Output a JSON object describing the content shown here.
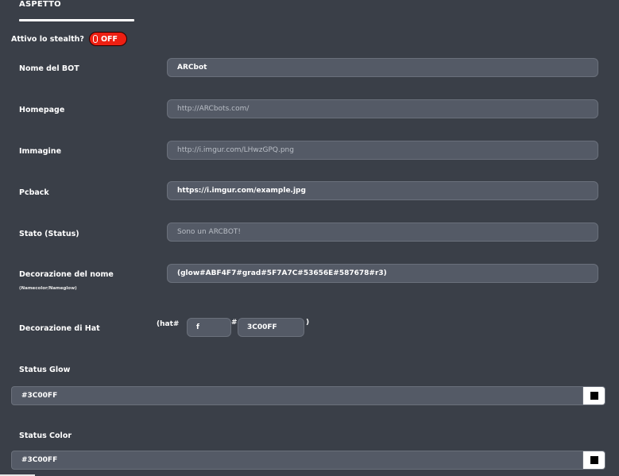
{
  "tab": {
    "title": "ASPETTO"
  },
  "stealth": {
    "label": "Attivo lo stealth?",
    "toggle_text": "OFF",
    "toggle_color": "#ee1f12"
  },
  "fields": {
    "bot_name": {
      "label": "Nome del BOT",
      "value": "ARCbot"
    },
    "homepage": {
      "label": "Homepage",
      "placeholder": "http://ARCbots.com/"
    },
    "image": {
      "label": "Immagine",
      "placeholder": "http://i.imgur.com/LHwzGPQ.png"
    },
    "pcback": {
      "label": "Pcback",
      "value": "https://i.imgur.com/example.jpg"
    },
    "status": {
      "label": "Stato (Status)",
      "placeholder": "Sono un ARCBOT!"
    },
    "name_decoration": {
      "label": "Decorazione del nome",
      "sub_label": "(Namecolor/Nameglow)",
      "value": "(glow#ABF4F7#grad#5F7A7C#53656E#587678#r3)"
    },
    "hat_decoration": {
      "label": "Decorazione di Hat",
      "prefix": "(hat#",
      "hash": "#",
      "suffix": ")",
      "code": "f",
      "color": "3C00FF"
    }
  },
  "status_glow": {
    "label": "Status Glow",
    "value": "#3C00FF",
    "swatch_color": "#000000"
  },
  "status_color": {
    "label": "Status Color",
    "value": "#3C00FF",
    "swatch_color": "#000000"
  }
}
